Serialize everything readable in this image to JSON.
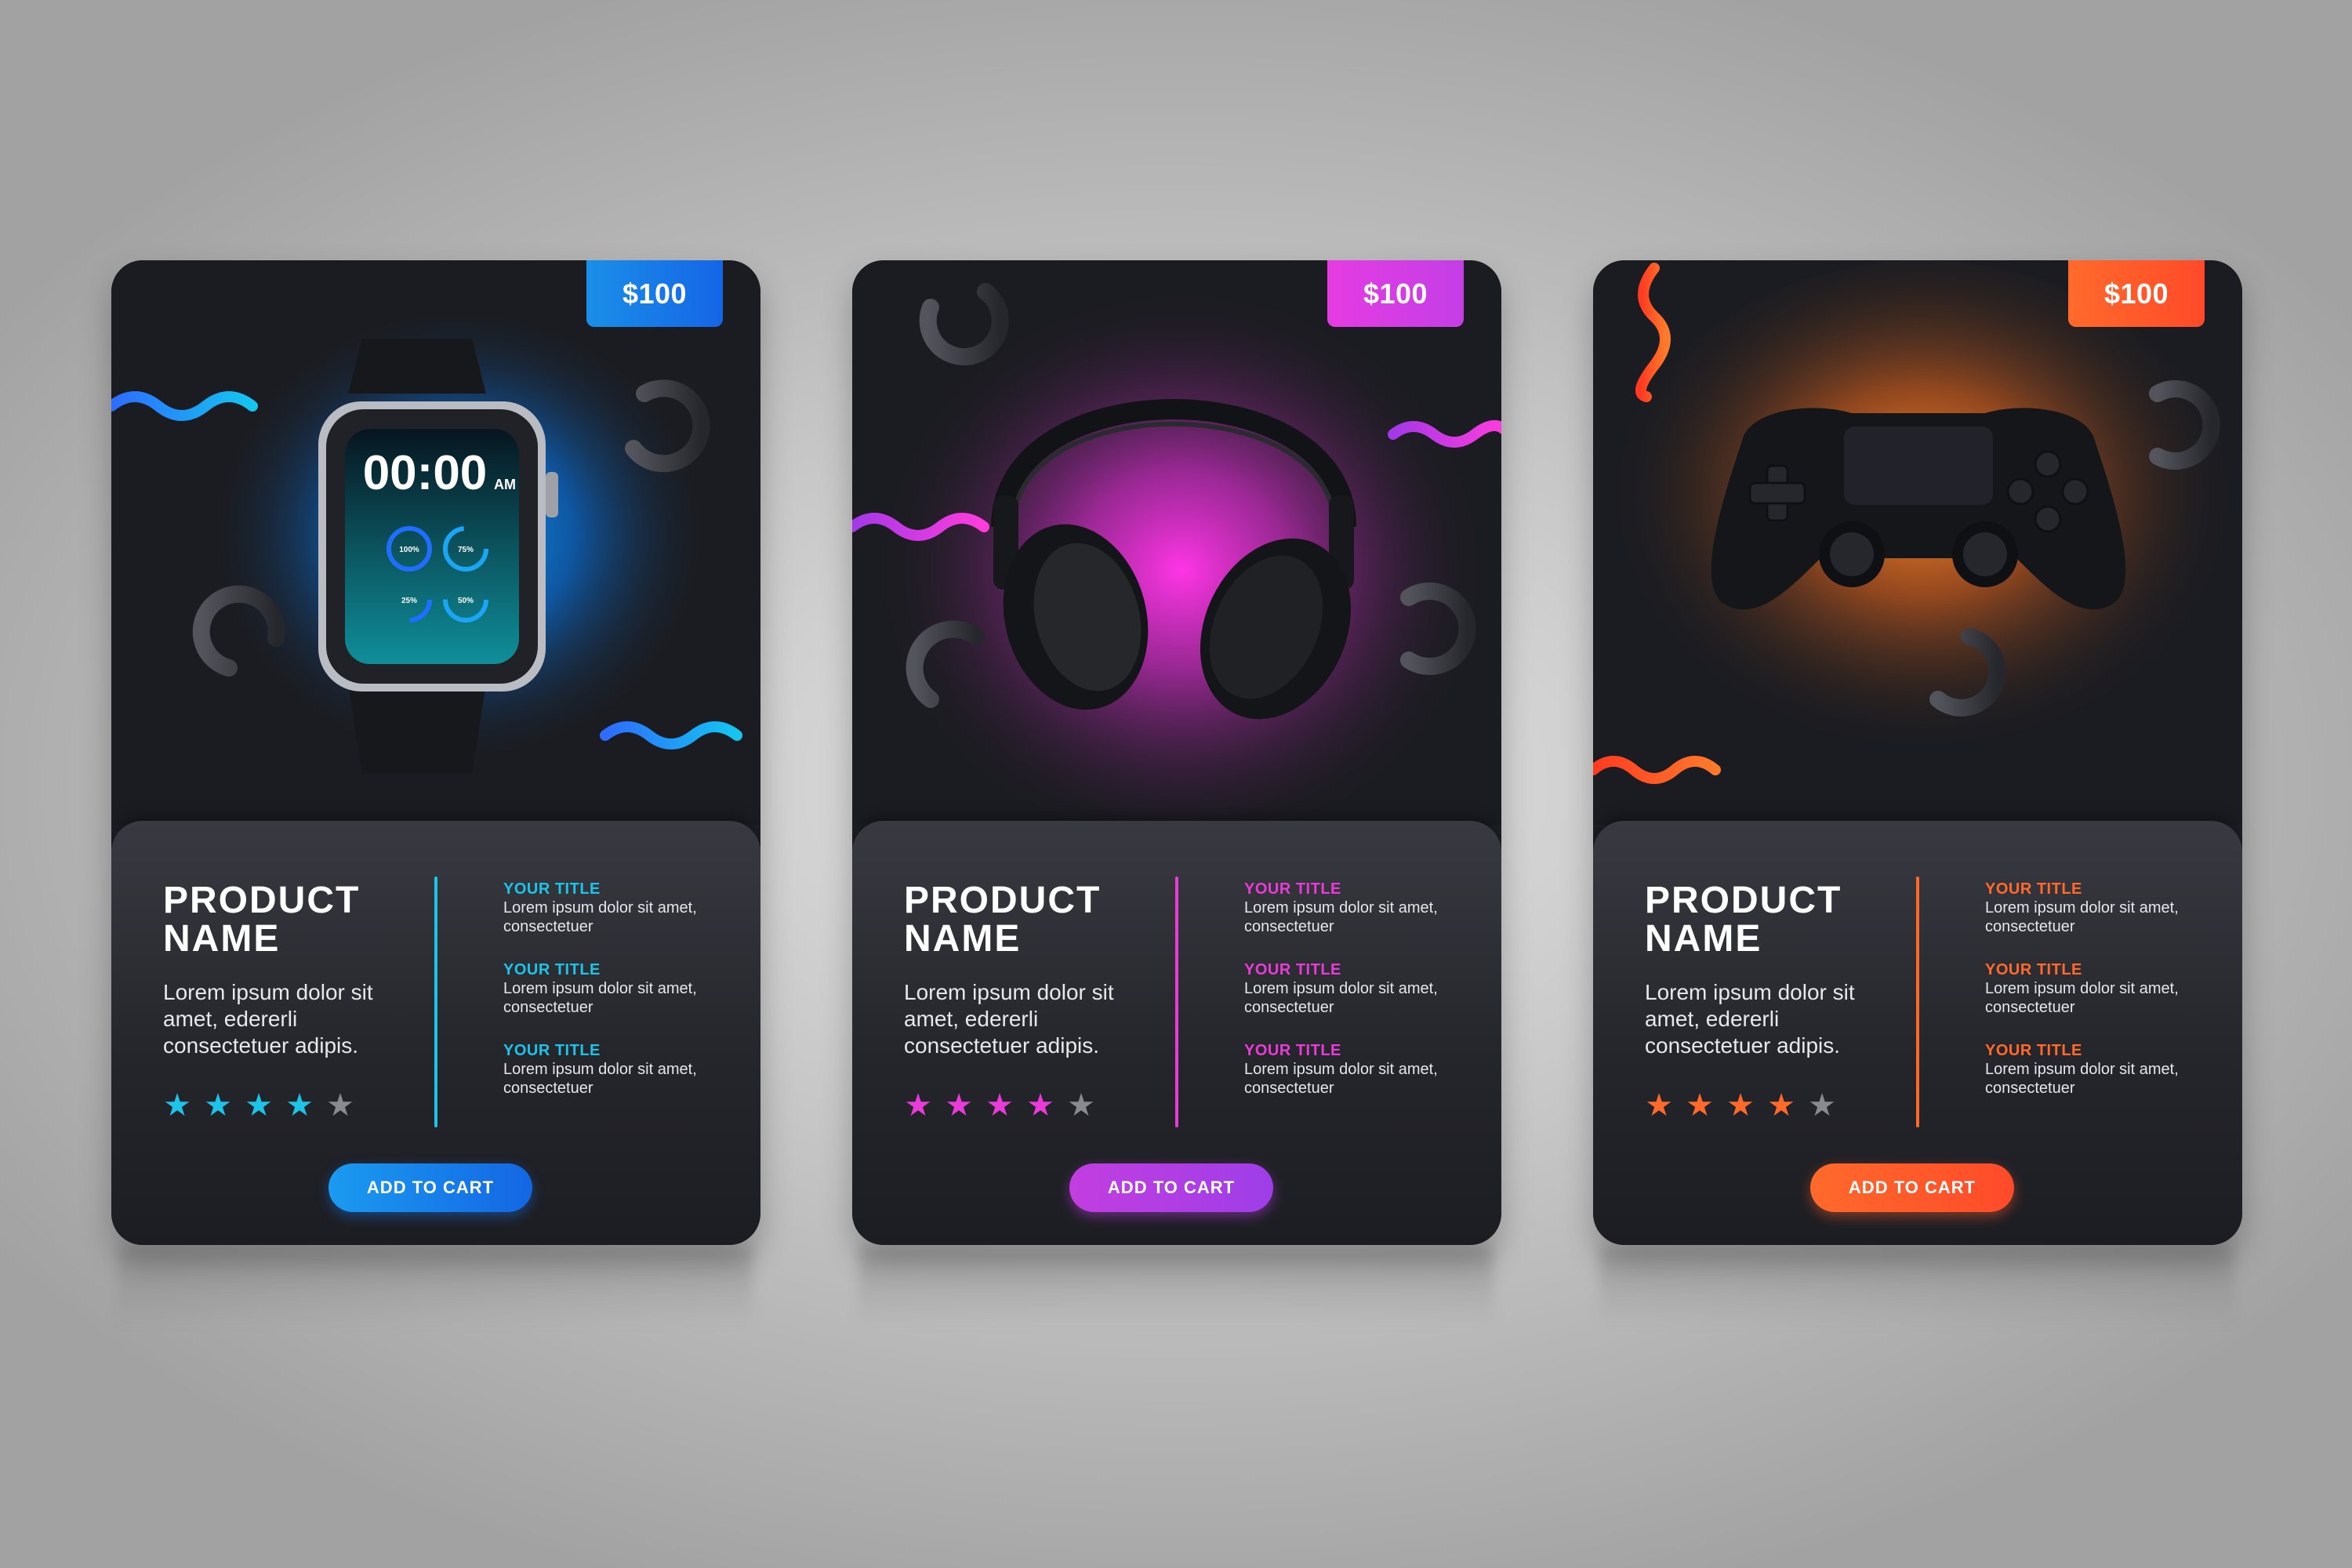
{
  "cards": [
    {
      "product": "smartwatch",
      "price": "$100",
      "name_line1": "PRODUCT",
      "name_line2": "NAME",
      "description": "Lorem ipsum dolor sit amet, edererli consectetuer adipis.",
      "rating": 4,
      "rating_max": 5,
      "star_glyph": "★",
      "accent": "#1ec3e8",
      "accent_button": "#1a8fe8",
      "watch_time": "00:00",
      "watch_ampm": "AM",
      "watch_rings": [
        "100%",
        "75%",
        "25%",
        "50%"
      ],
      "specs": [
        {
          "title": "YOUR TITLE",
          "text": "Lorem ipsum dolor sit amet, consectetuer"
        },
        {
          "title": "YOUR TITLE",
          "text": "Lorem ipsum dolor sit amet, consectetuer"
        },
        {
          "title": "YOUR TITLE",
          "text": "Lorem ipsum dolor sit amet, consectetuer"
        }
      ],
      "cta": "ADD TO CART"
    },
    {
      "product": "headphones",
      "price": "$100",
      "name_line1": "PRODUCT",
      "name_line2": "NAME",
      "description": "Lorem ipsum dolor sit amet, edererli consectetuer adipis.",
      "rating": 4,
      "rating_max": 5,
      "star_glyph": "★",
      "accent": "#e93bd7",
      "accent_button": "#c23ee0",
      "specs": [
        {
          "title": "YOUR TITLE",
          "text": "Lorem ipsum dolor sit amet, consectetuer"
        },
        {
          "title": "YOUR TITLE",
          "text": "Lorem ipsum dolor sit amet, consectetuer"
        },
        {
          "title": "YOUR TITLE",
          "text": "Lorem ipsum dolor sit amet, consectetuer"
        }
      ],
      "cta": "ADD TO CART"
    },
    {
      "product": "game-controller",
      "price": "$100",
      "name_line1": "PRODUCT",
      "name_line2": "NAME",
      "description": "Lorem ipsum dolor sit amet, edererli consectetuer adipis.",
      "rating": 4,
      "rating_max": 5,
      "star_glyph": "★",
      "accent": "#ff6a2b",
      "accent_button": "#ff5a2a",
      "specs": [
        {
          "title": "YOUR TITLE",
          "text": "Lorem ipsum dolor sit amet, consectetuer"
        },
        {
          "title": "YOUR TITLE",
          "text": "Lorem ipsum dolor sit amet, consectetuer"
        },
        {
          "title": "YOUR TITLE",
          "text": "Lorem ipsum dolor sit amet, consectetuer"
        }
      ],
      "cta": "ADD TO CART"
    }
  ],
  "colors": {
    "inactive_star": "#8a8a8e",
    "blue_start": "#1ac6f5",
    "blue_end": "#1565e6",
    "magenta_start": "#ff3ddc",
    "magenta_end": "#a636e8",
    "orange_start": "#ff7b2a",
    "orange_end": "#ff4a2a"
  }
}
